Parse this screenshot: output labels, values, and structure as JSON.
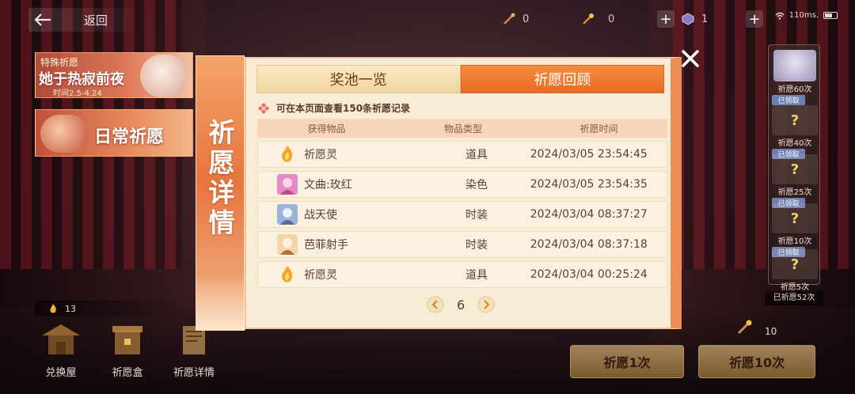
{
  "top_bar": {
    "back_label": "返回",
    "res1_value": "0",
    "res2_value": "0",
    "res3_value": "1",
    "network": "110ms."
  },
  "left_panel": {
    "special_banner": {
      "tag": "特殊祈愿",
      "title": "她于热寂前夜",
      "dates": "时间2.5-4.24"
    },
    "daily_banner": {
      "title": "日常祈愿"
    },
    "coin_count": "13",
    "nav": [
      {
        "label": "兑换屋",
        "icon": "pavilion-icon"
      },
      {
        "label": "祈愿盒",
        "icon": "wish-box-icon"
      },
      {
        "label": "祈愿详情",
        "icon": "scroll-icon"
      }
    ]
  },
  "right_panel": {
    "milestones": [
      {
        "label": "祈愿60次",
        "tag": "已领取"
      },
      {
        "label": "祈愿40次",
        "tag": "已领取",
        "box": "?"
      },
      {
        "label": "祈愿25次",
        "tag": "已领取",
        "box": "?"
      },
      {
        "label": "祈愿10次",
        "tag": "已领取",
        "box": "?"
      },
      {
        "label": "祈愿5次",
        "box": "?"
      }
    ],
    "total": "已祈愿52次",
    "cost": "10",
    "wish_once": "祈愿1次",
    "wish_ten": "祈愿10次"
  },
  "dialog": {
    "side_title": "祈愿详情",
    "tabs": [
      {
        "label": "奖池一览",
        "active": false
      },
      {
        "label": "祈愿回顾",
        "active": true
      }
    ],
    "info_text": "可在本页面查看150条祈愿记录",
    "headers": {
      "name": "获得物品",
      "type": "物品类型",
      "time": "祈愿时间"
    },
    "records": [
      {
        "name": "祈愿灵",
        "type": "道具",
        "time": "2024/03/05 23:54:45",
        "icon": "flame-icon"
      },
      {
        "name": "文曲:玫红",
        "type": "染色",
        "time": "2024/03/05 23:54:35",
        "icon": "character-avatar-icon"
      },
      {
        "name": "战天使",
        "type": "时装",
        "time": "2024/03/04 08:37:27",
        "icon": "character-avatar-icon"
      },
      {
        "name": "芭菲射手",
        "type": "时装",
        "time": "2024/03/04 08:37:18",
        "icon": "character-avatar-icon"
      },
      {
        "name": "祈愿灵",
        "type": "道具",
        "time": "2024/03/04 00:25:24",
        "icon": "flame-icon"
      }
    ],
    "page": "6"
  },
  "colors": {
    "accent_orange": "#e96a22",
    "panel_bg": "#f8ecd7",
    "header_bg": "#f6d5ba"
  }
}
